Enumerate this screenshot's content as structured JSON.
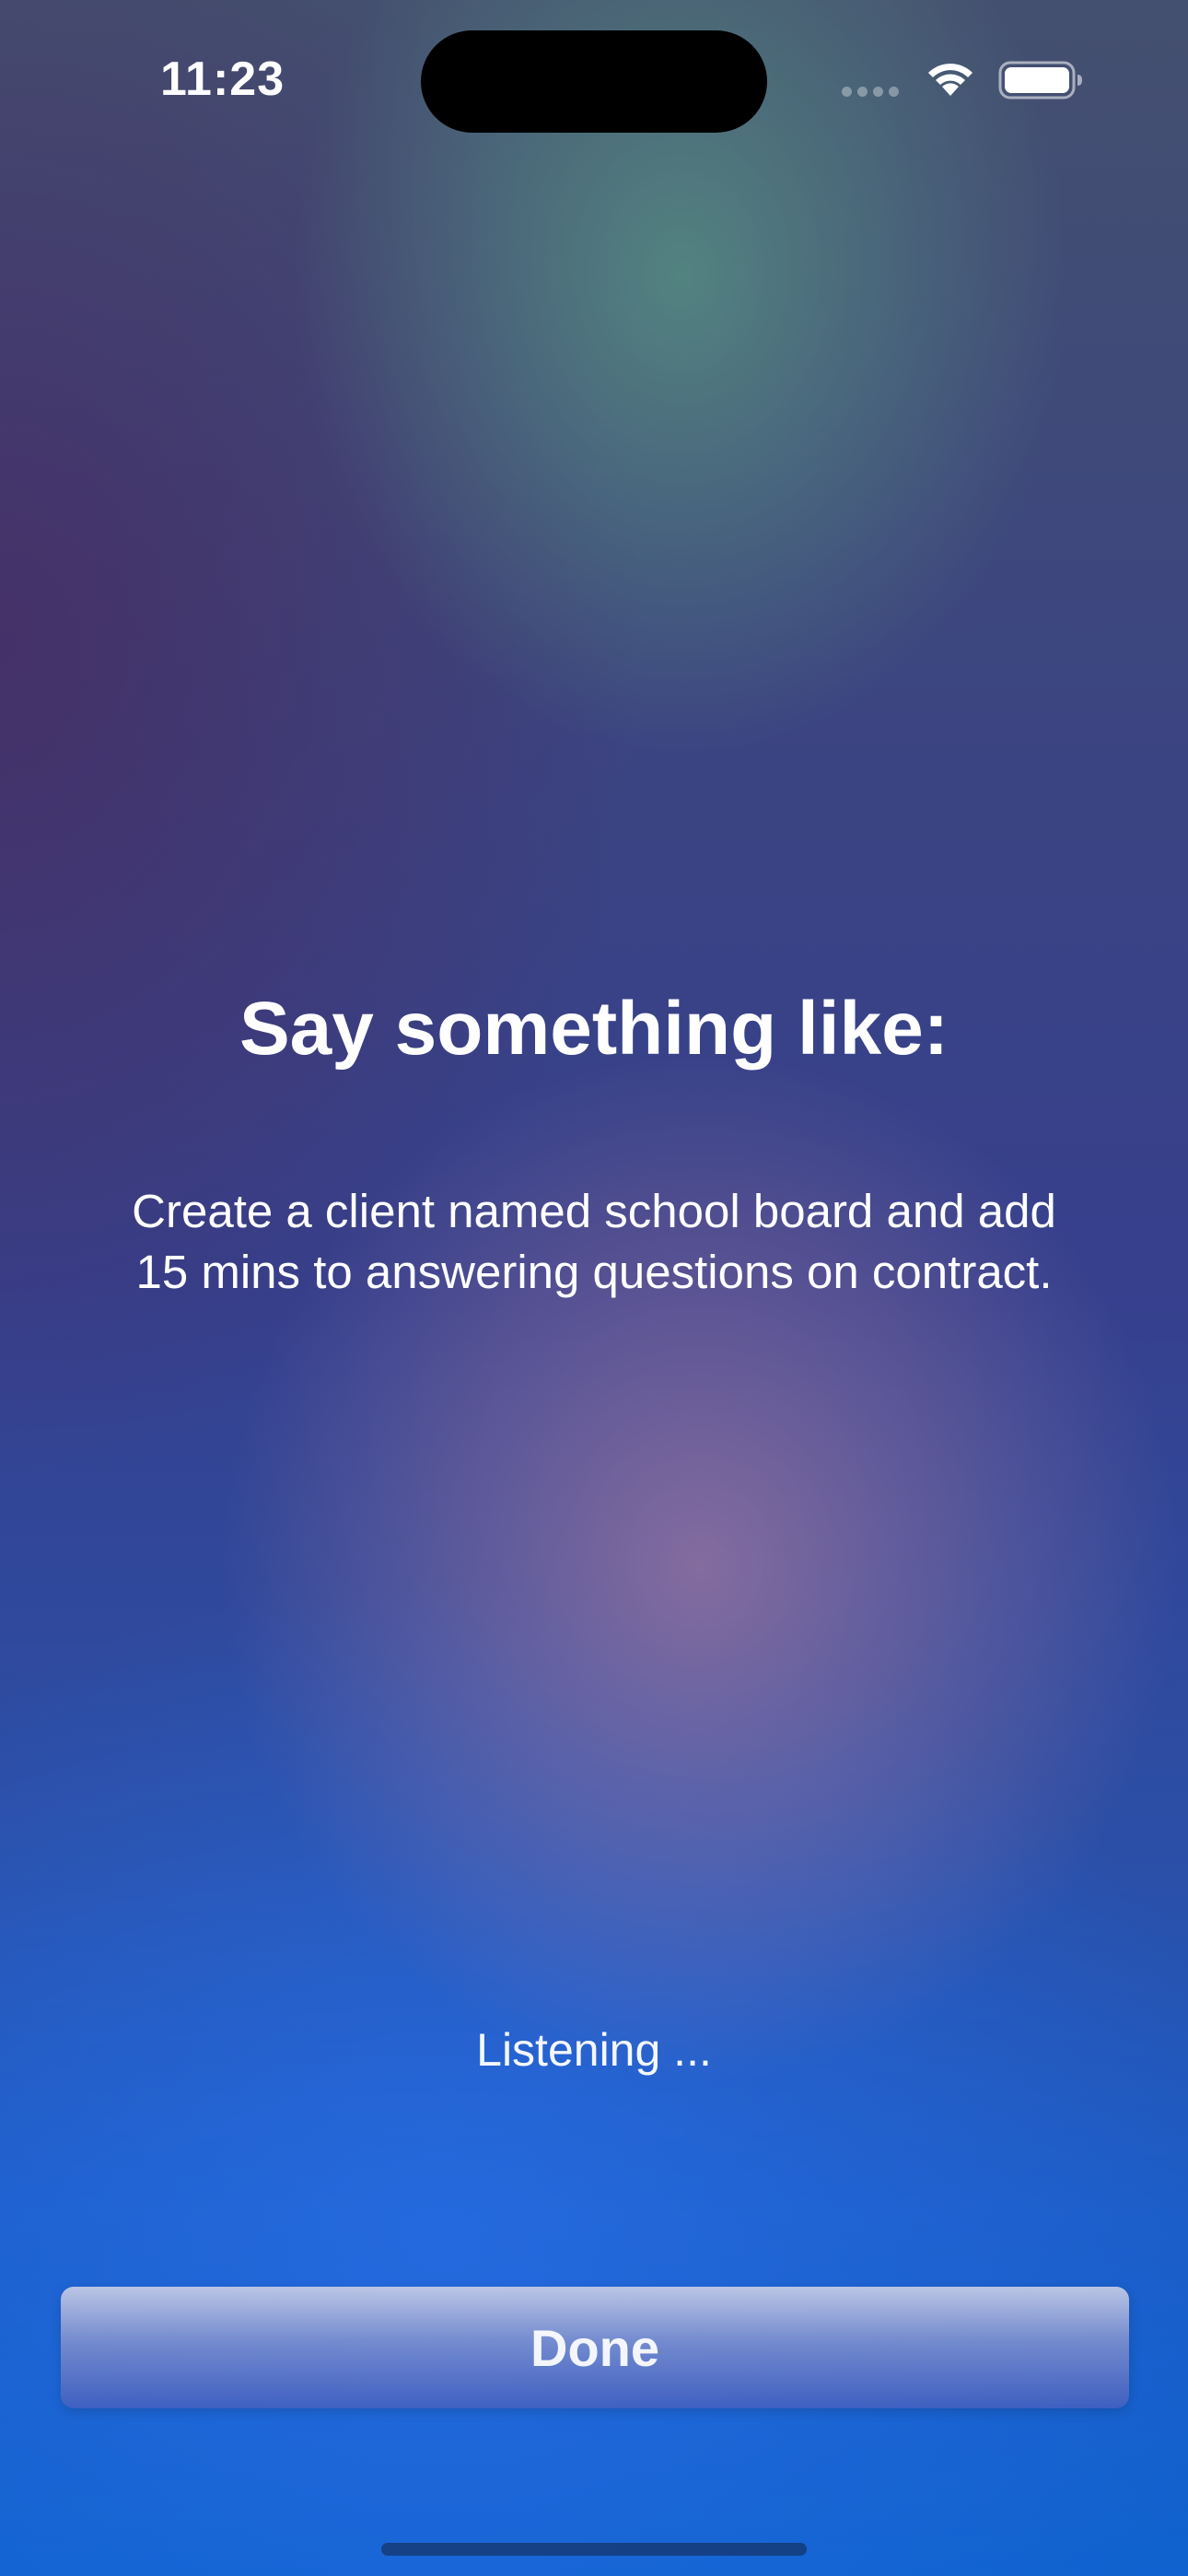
{
  "status_bar": {
    "time": "11:23",
    "signal_icon": "cellular-signal-icon",
    "wifi_icon": "wifi-icon",
    "battery_icon": "battery-icon"
  },
  "main": {
    "heading": "Say something like:",
    "example_line_1": "Create a client named school board and add",
    "example_line_2": "15 mins to answering questions on contract.",
    "listening_status": "Listening ..."
  },
  "actions": {
    "done_label": "Done"
  },
  "colors": {
    "background_top": "#44506f",
    "background_bottom": "#0f62cf",
    "text": "#ffffff"
  }
}
